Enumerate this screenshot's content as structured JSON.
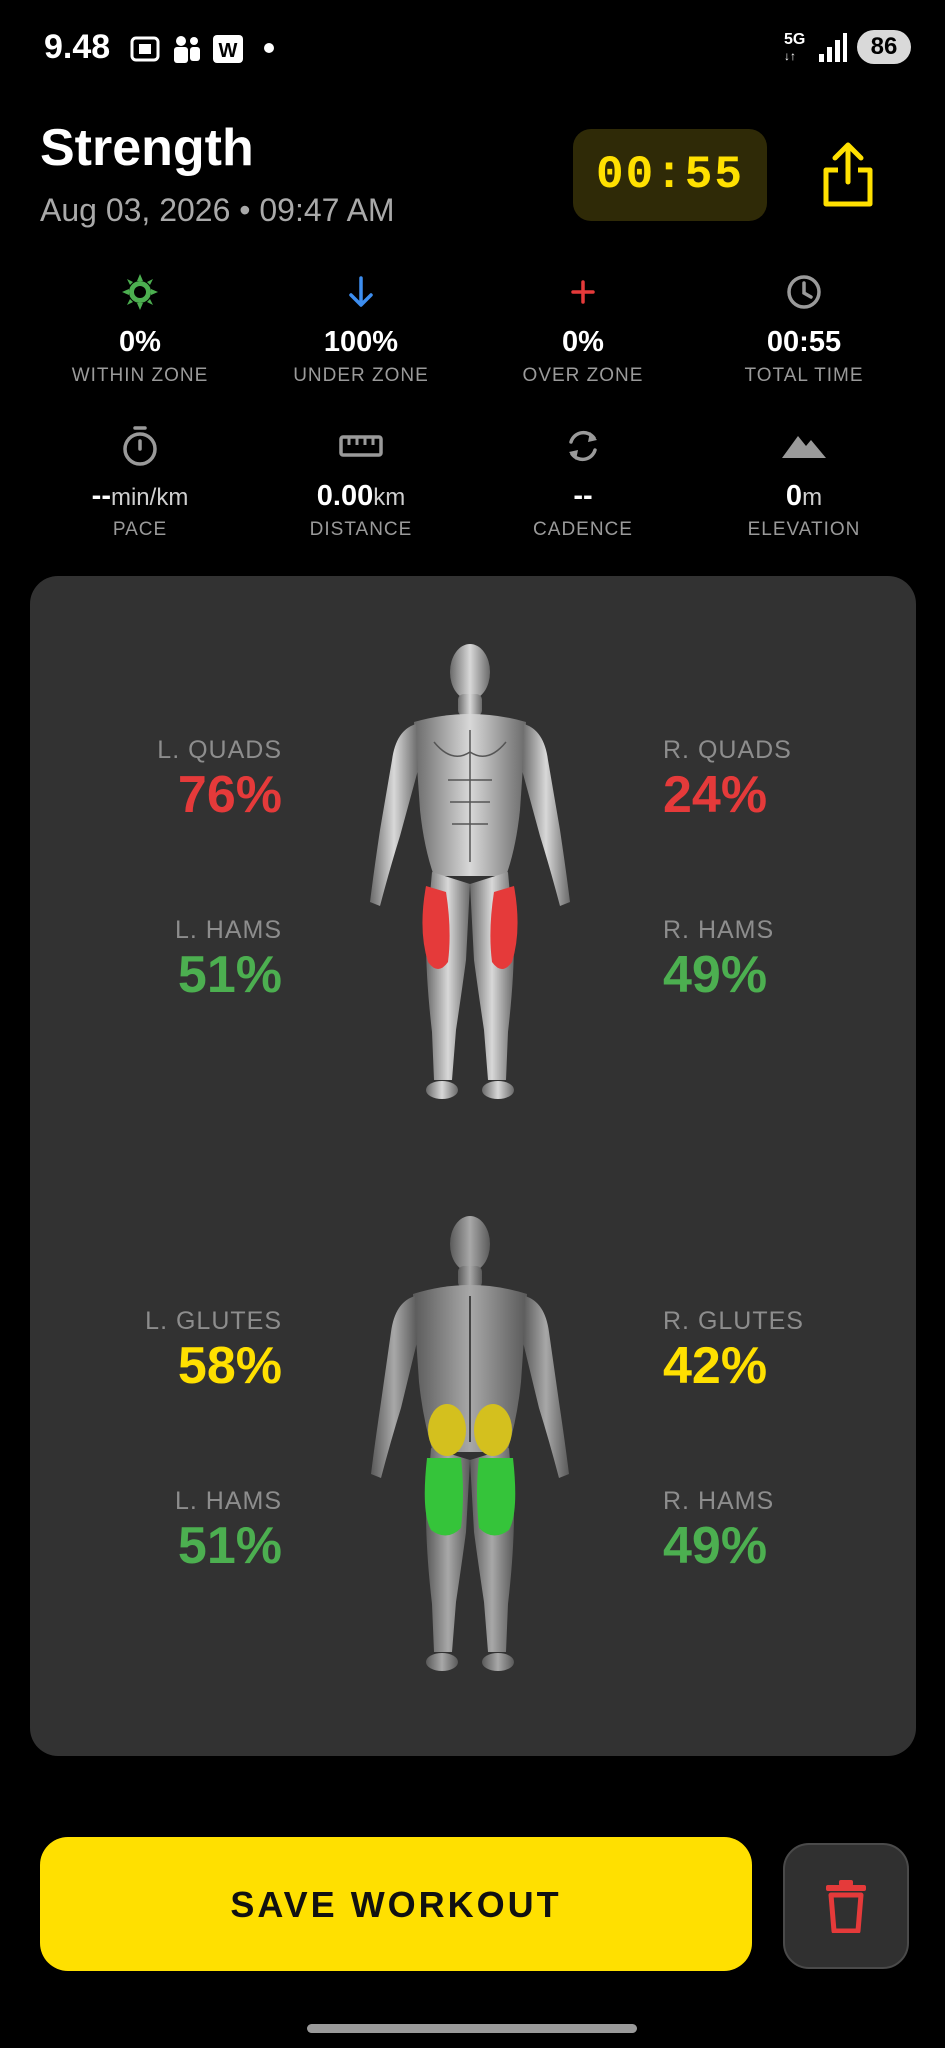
{
  "status_bar": {
    "time": "9.48",
    "network": "5G",
    "battery": "86"
  },
  "header": {
    "title": "Strength",
    "datetime": "Aug 03, 2026 • 09:47 AM",
    "timer": "00:55"
  },
  "stats": [
    {
      "icon": "sun-icon",
      "value": "0%",
      "unit": "",
      "label": "WITHIN ZONE",
      "color": "#4caf50"
    },
    {
      "icon": "arrow-down-icon",
      "value": "100%",
      "unit": "",
      "label": "UNDER ZONE",
      "color": "#3d8ef0"
    },
    {
      "icon": "plus-icon",
      "value": "0%",
      "unit": "",
      "label": "OVER ZONE",
      "color": "#e53a3a"
    },
    {
      "icon": "clock-icon",
      "value": "00:55",
      "unit": "",
      "label": "TOTAL TIME",
      "color": "#9a9a9a"
    },
    {
      "icon": "stopwatch-icon",
      "value": "--",
      "unit": "min/km",
      "label": "PACE",
      "color": "#9a9a9a"
    },
    {
      "icon": "ruler-icon",
      "value": "0.00",
      "unit": "km",
      "label": "DISTANCE",
      "color": "#9a9a9a"
    },
    {
      "icon": "cadence-icon",
      "value": "--",
      "unit": "",
      "label": "CADENCE",
      "color": "#9a9a9a"
    },
    {
      "icon": "mountain-icon",
      "value": "0",
      "unit": "m",
      "label": "ELEVATION",
      "color": "#9a9a9a"
    }
  ],
  "front": {
    "l_quads": {
      "label": "L. QUADS",
      "value": "76%"
    },
    "r_quads": {
      "label": "R. QUADS",
      "value": "24%"
    },
    "l_hams": {
      "label": "L. HAMS",
      "value": "51%"
    },
    "r_hams": {
      "label": "R. HAMS",
      "value": "49%"
    }
  },
  "back": {
    "l_glutes": {
      "label": "L. GLUTES",
      "value": "58%"
    },
    "r_glutes": {
      "label": "R. GLUTES",
      "value": "42%"
    },
    "l_hams": {
      "label": "L. HAMS",
      "value": "51%"
    },
    "r_hams": {
      "label": "R. HAMS",
      "value": "49%"
    }
  },
  "colors": {
    "accent": "#ffe000",
    "red": "#e53a3a",
    "green": "#4caf50",
    "yellow": "#ffe000"
  },
  "actions": {
    "save_label": "SAVE WORKOUT"
  }
}
